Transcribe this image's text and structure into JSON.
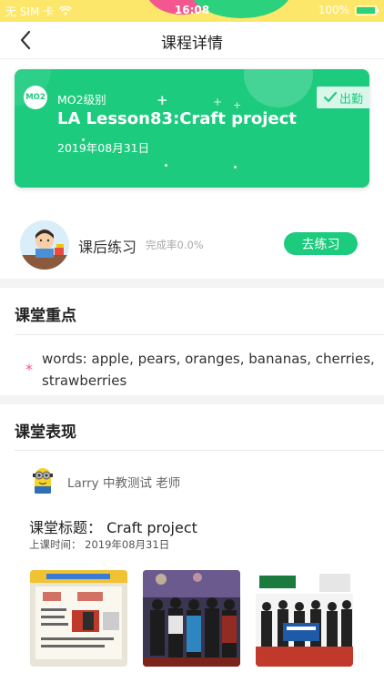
{
  "status_bar": {
    "carrier": "无 SIM 卡",
    "time": "16:08",
    "battery": "100%",
    "battery_level": 1.0
  },
  "nav": {
    "title": "课程详情"
  },
  "lesson_card": {
    "level_badge": "MO2",
    "level_text": "MO2级别",
    "title": "LA Lesson83:Craft project",
    "date": "2019年08月31日",
    "attendance": "出勤",
    "colors": {
      "background": "#1dcb7f",
      "attendance_bg": "#d9f6ea"
    }
  },
  "homework": {
    "label": "课后练习",
    "completion": "完成率0.0%",
    "completion_rate": 0.0,
    "button": "去练习"
  },
  "key_points": {
    "title": "课堂重点",
    "items": [
      "words: apple, pears, oranges, bananas, cherries, strawberries"
    ]
  },
  "performance": {
    "title": "课堂表现",
    "teacher": "Larry 中教测试 老师",
    "class_title": "课堂标题： Craft project",
    "class_time": "上课时间： 2019年08月31日"
  },
  "accent_color": "#1dcb7f",
  "highlight_color": "#f2588f"
}
